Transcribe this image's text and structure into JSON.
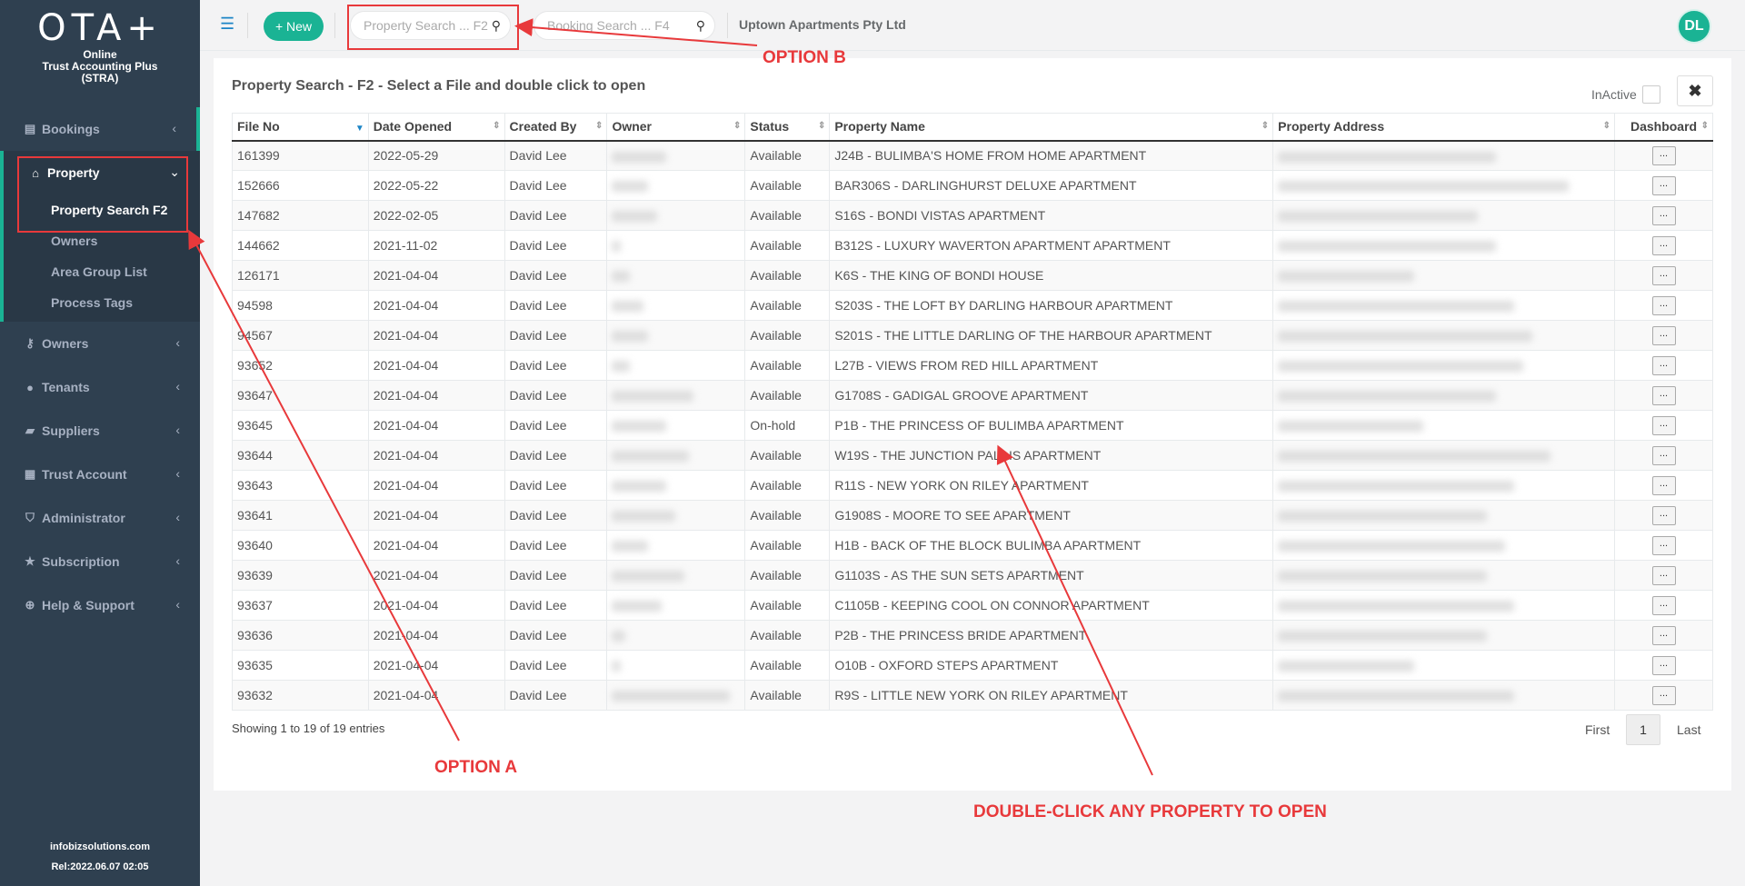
{
  "sidebar": {
    "logo": "OTA+",
    "logo_sub": [
      "Online",
      "Trust Accounting Plus",
      "(STRA)"
    ],
    "items": [
      {
        "label": "Bookings",
        "icon": "book-icon"
      },
      {
        "label": "Property",
        "icon": "home-icon"
      },
      {
        "label": "Owners",
        "icon": "key-icon"
      },
      {
        "label": "Tenants",
        "icon": "user-icon"
      },
      {
        "label": "Suppliers",
        "icon": "truck-icon"
      },
      {
        "label": "Trust Account",
        "icon": "calculator-icon"
      },
      {
        "label": "Administrator",
        "icon": "shield-icon"
      },
      {
        "label": "Subscription",
        "icon": "star-icon"
      },
      {
        "label": "Help & Support",
        "icon": "globe-icon"
      }
    ],
    "property_sub": [
      "Property Search F2",
      "Owners",
      "Area Group List",
      "Process Tags"
    ],
    "footer_site": "infobizsolutions.com",
    "footer_rel": "Rel:2022.06.07 02:05"
  },
  "topbar": {
    "new_label": "+ New",
    "property_search_placeholder": "Property Search ... F2",
    "booking_search_placeholder": "Booking Search ... F4",
    "company": "Uptown Apartments Pty Ltd",
    "avatar": "DL"
  },
  "panel": {
    "title": "Property Search - F2 - Select a File and double click to open",
    "inactive_label": "InActive",
    "close_glyph": "✖"
  },
  "table": {
    "headers": [
      "File No",
      "Date Opened",
      "Created By",
      "Owner",
      "Status",
      "Property Name",
      "Property Address",
      "Dashboard"
    ],
    "dashboard_btn": "...",
    "rows": [
      {
        "file": "161399",
        "date": "2022-05-29",
        "by": "David Lee",
        "status": "Available",
        "name": "J24B - BULIMBA'S HOME FROM HOME APARTMENT"
      },
      {
        "file": "152666",
        "date": "2022-05-22",
        "by": "David Lee",
        "status": "Available",
        "name": "BAR306S - DARLINGHURST DELUXE APARTMENT"
      },
      {
        "file": "147682",
        "date": "2022-02-05",
        "by": "David Lee",
        "status": "Available",
        "name": "S16S - BONDI VISTAS APARTMENT"
      },
      {
        "file": "144662",
        "date": "2021-11-02",
        "by": "David Lee",
        "status": "Available",
        "name": "B312S - LUXURY WAVERTON APARTMENT APARTMENT"
      },
      {
        "file": "126171",
        "date": "2021-04-04",
        "by": "David Lee",
        "status": "Available",
        "name": "K6S - THE KING OF BONDI HOUSE"
      },
      {
        "file": "94598",
        "date": "2021-04-04",
        "by": "David Lee",
        "status": "Available",
        "name": "S203S - THE LOFT BY DARLING HARBOUR APARTMENT"
      },
      {
        "file": "94567",
        "date": "2021-04-04",
        "by": "David Lee",
        "status": "Available",
        "name": "S201S - THE LITTLE DARLING OF THE HARBOUR APARTMENT"
      },
      {
        "file": "93652",
        "date": "2021-04-04",
        "by": "David Lee",
        "status": "Available",
        "name": "L27B - VIEWS FROM RED HILL APARTMENT"
      },
      {
        "file": "93647",
        "date": "2021-04-04",
        "by": "David Lee",
        "status": "Available",
        "name": "G1708S - GADIGAL GROOVE APARTMENT"
      },
      {
        "file": "93645",
        "date": "2021-04-04",
        "by": "David Lee",
        "status": "On-hold",
        "name": "P1B - THE PRINCESS OF BULIMBA APARTMENT"
      },
      {
        "file": "93644",
        "date": "2021-04-04",
        "by": "David Lee",
        "status": "Available",
        "name": "W19S - THE JUNCTION PALAIS APARTMENT"
      },
      {
        "file": "93643",
        "date": "2021-04-04",
        "by": "David Lee",
        "status": "Available",
        "name": "R11S - NEW YORK ON RILEY APARTMENT"
      },
      {
        "file": "93641",
        "date": "2021-04-04",
        "by": "David Lee",
        "status": "Available",
        "name": "G1908S - MOORE TO SEE APARTMENT"
      },
      {
        "file": "93640",
        "date": "2021-04-04",
        "by": "David Lee",
        "status": "Available",
        "name": "H1B - BACK OF THE BLOCK BULIMBA APARTMENT"
      },
      {
        "file": "93639",
        "date": "2021-04-04",
        "by": "David Lee",
        "status": "Available",
        "name": "G1103S - AS THE SUN SETS APARTMENT"
      },
      {
        "file": "93637",
        "date": "2021-04-04",
        "by": "David Lee",
        "status": "Available",
        "name": "C1105B - KEEPING COOL ON CONNOR APARTMENT"
      },
      {
        "file": "93636",
        "date": "2021-04-04",
        "by": "David Lee",
        "status": "Available",
        "name": "P2B - THE PRINCESS BRIDE APARTMENT"
      },
      {
        "file": "93635",
        "date": "2021-04-04",
        "by": "David Lee",
        "status": "Available",
        "name": "O10B - OXFORD STEPS APARTMENT"
      },
      {
        "file": "93632",
        "date": "2021-04-04",
        "by": "David Lee",
        "status": "Available",
        "name": "R9S - LITTLE NEW YORK ON RILEY APARTMENT"
      }
    ]
  },
  "footer": {
    "showing": "Showing 1 to 19 of 19 entries",
    "first": "First",
    "page": "1",
    "last": "Last"
  },
  "annotations": {
    "option_a": "OPTION A",
    "option_b": "OPTION B",
    "double_click": "DOUBLE-CLICK ANY PROPERTY TO OPEN"
  },
  "colors": {
    "accent": "#1ab394",
    "sidebar": "#2f4050",
    "annotation": "#e8393b"
  }
}
